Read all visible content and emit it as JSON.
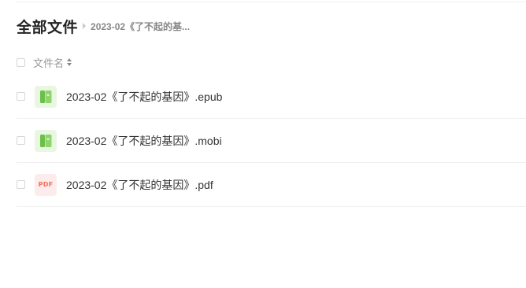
{
  "breadcrumb": {
    "root": "全部文件",
    "current": "2023-02《了不起的基..."
  },
  "list": {
    "column_name": "文件名"
  },
  "files": [
    {
      "name": "2023-02《了不起的基因》.epub",
      "icon": "ebook-icon"
    },
    {
      "name": "2023-02《了不起的基因》.mobi",
      "icon": "ebook-icon"
    },
    {
      "name": "2023-02《了不起的基因》.pdf",
      "icon": "pdf-icon",
      "icon_text": "PDF"
    }
  ],
  "colors": {
    "ebook_icon_green": "#6cc04a",
    "pdf_icon_red": "#f2705e"
  }
}
